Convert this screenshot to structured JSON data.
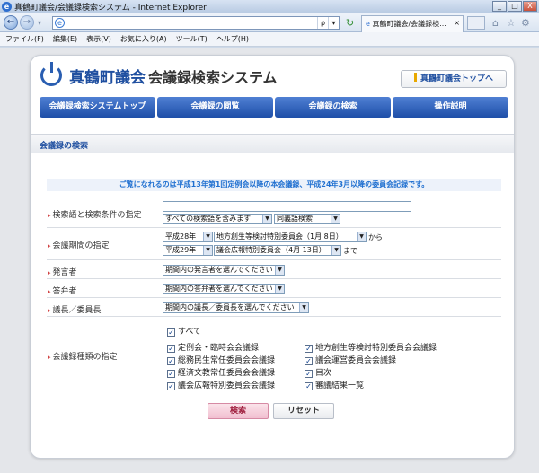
{
  "window": {
    "title": "真鶴町議会/会議録検索システム - Internet Explorer",
    "min": "_",
    "max": "□",
    "close": "X"
  },
  "browser": {
    "tab_title": "真鶴町議会/会議録検...",
    "tab_close": "×",
    "addr_search": "ρ",
    "addr_dropdown": "▾",
    "addr_refresh": "↻"
  },
  "menu": [
    "ファイル(F)",
    "編集(E)",
    "表示(V)",
    "お気に入り(A)",
    "ツール(T)",
    "ヘルプ(H)"
  ],
  "site": {
    "name": "真鶴町議会",
    "subtitle": "会議録検索システム",
    "top_link": "真鶴町議会トップへ",
    "nav": [
      "会議録検索システムトップ",
      "会議録の閲覧",
      "会議録の検索",
      "操作説明"
    ]
  },
  "section_title": "会議録の検索",
  "notice": "ご覧になれるのは平成13年第1回定例会以降の本会議録、平成24年3月以降の委員会記録です。",
  "form": {
    "keyword": {
      "label": "検索語と検索条件の指定",
      "value": "",
      "cond1": "すべての検索語を含みます",
      "cond2": "同義語検索"
    },
    "period": {
      "label": "会議期間の指定",
      "from_year": "平成28年",
      "from_meeting": "地方創生等検討特別委員会（1月 8日）",
      "from_suffix": "から",
      "to_year": "平成29年",
      "to_meeting": "議会広報特別委員会（4月 13日）",
      "to_suffix": "まで"
    },
    "speaker": {
      "label": "発言者",
      "value": "期間内の発言者を選んでください"
    },
    "answerer": {
      "label": "答弁者",
      "value": "期間内の答弁者を選んでください"
    },
    "chair": {
      "label": "議長／委員長",
      "value": "期間内の議長／委員長を選んでください"
    },
    "types": {
      "label": "会議録種類の指定",
      "all": "すべて",
      "items": [
        "定例会・臨時会会議録",
        "地方創生等検討特別委員会会議録",
        "総務民生常任委員会会議録",
        "議会運営委員会会議録",
        "経済文教常任委員会会議録",
        "目次",
        "議会広報特別委員会会議録",
        "審議結果一覧"
      ]
    },
    "search_button": "検索",
    "reset_button": "リセット"
  }
}
